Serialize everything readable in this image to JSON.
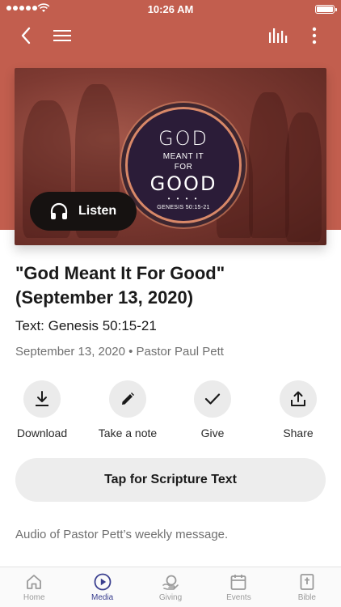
{
  "status_bar": {
    "time": "10:26 AM"
  },
  "nav": {
    "back_icon": "chevron-left-icon",
    "menu_icon": "hamburger-icon",
    "audio_icon": "equalizer-icon",
    "more_icon": "more-vertical-icon"
  },
  "artwork": {
    "title_line1": "GOD",
    "title_line2": "MEANT IT",
    "title_line3": "FOR",
    "title_line4": "GOOD",
    "dots": "• • • •",
    "reference": "GENESIS 50:15-21"
  },
  "listen_button": {
    "label": "Listen",
    "icon": "headphones-icon"
  },
  "sermon": {
    "title": "\"God Meant It For Good\" (September 13, 2020)",
    "scripture": "Text: Genesis 50:15-21",
    "meta": "September 13, 2020 • Pastor Paul Pett"
  },
  "actions": [
    {
      "label": "Download",
      "icon": "download-icon"
    },
    {
      "label": "Take a note",
      "icon": "pencil-icon"
    },
    {
      "label": "Give",
      "icon": "checkmark-icon"
    },
    {
      "label": "Share",
      "icon": "share-icon"
    }
  ],
  "scripture_button": {
    "label": "Tap for Scripture Text"
  },
  "description": "Audio of Pastor Pett’s weekly message.",
  "tabs": [
    {
      "label": "Home",
      "icon": "home-icon",
      "active": false
    },
    {
      "label": "Media",
      "icon": "play-circle-icon",
      "active": true
    },
    {
      "label": "Giving",
      "icon": "giving-icon",
      "active": false
    },
    {
      "label": "Events",
      "icon": "calendar-icon",
      "active": false
    },
    {
      "label": "Bible",
      "icon": "bible-icon",
      "active": false
    }
  ],
  "colors": {
    "header": "#c25e4e",
    "accent": "#3a3f8f",
    "listen_bg": "#161211"
  }
}
